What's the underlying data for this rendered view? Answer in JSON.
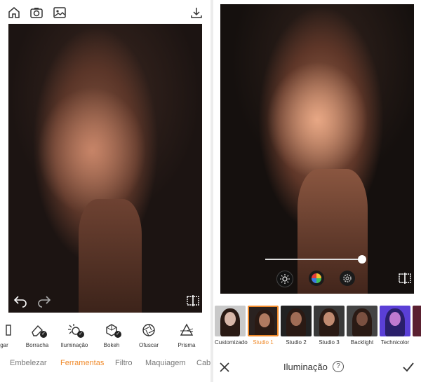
{
  "left": {
    "top_icons": [
      "home-icon",
      "camera-icon",
      "gallery-icon",
      "download-icon"
    ],
    "tools": [
      {
        "label": "gar"
      },
      {
        "label": "Borracha"
      },
      {
        "label": "Iluminação"
      },
      {
        "label": "Bokeh"
      },
      {
        "label": "Ofuscar"
      },
      {
        "label": "Prisma"
      }
    ],
    "tabs": [
      {
        "label": "Embelezar",
        "active": false
      },
      {
        "label": "Ferramentas",
        "active": true
      },
      {
        "label": "Filtro",
        "active": false
      },
      {
        "label": "Maquiagem",
        "active": false
      },
      {
        "label": "Cab",
        "active": false
      }
    ]
  },
  "right": {
    "slider": {
      "value": 0.95
    },
    "presets": [
      {
        "label": "Customizado"
      },
      {
        "label": "Studio 1",
        "selected": true
      },
      {
        "label": "Studio 2"
      },
      {
        "label": "Studio 3"
      },
      {
        "label": "Backlight"
      },
      {
        "label": "Technicolor"
      }
    ],
    "bottom_title": "Iluminação",
    "help_symbol": "?"
  },
  "colors": {
    "accent": "#f08a2a",
    "technicolor": "#5a3fd6"
  }
}
